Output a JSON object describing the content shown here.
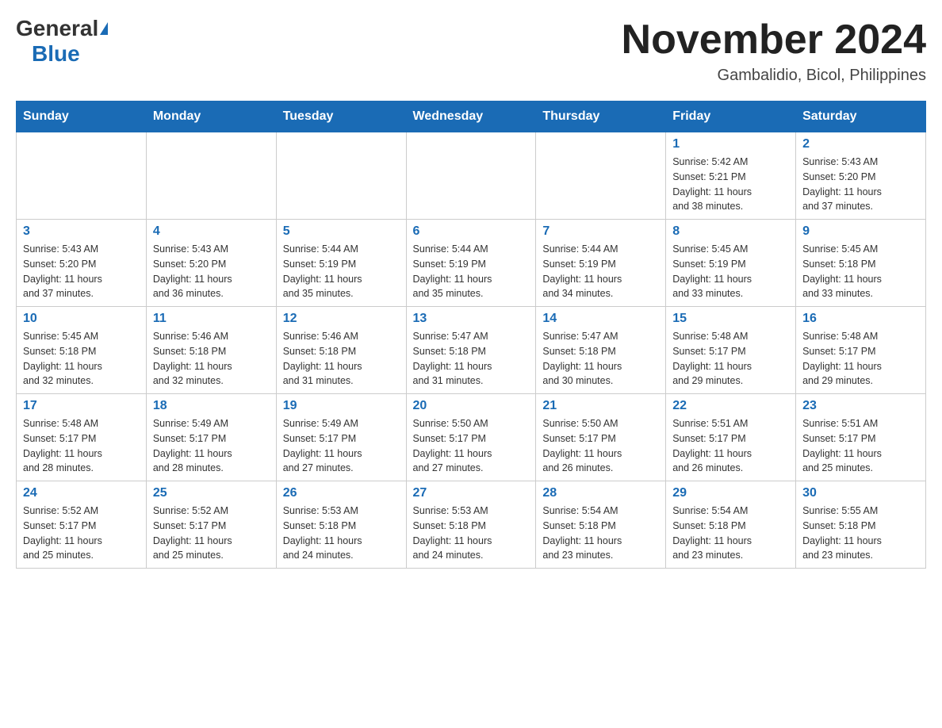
{
  "logo": {
    "general": "General",
    "blue": "Blue"
  },
  "title": {
    "month_year": "November 2024",
    "location": "Gambalidio, Bicol, Philippines"
  },
  "weekdays": [
    "Sunday",
    "Monday",
    "Tuesday",
    "Wednesday",
    "Thursday",
    "Friday",
    "Saturday"
  ],
  "weeks": [
    [
      {
        "day": "",
        "info": ""
      },
      {
        "day": "",
        "info": ""
      },
      {
        "day": "",
        "info": ""
      },
      {
        "day": "",
        "info": ""
      },
      {
        "day": "",
        "info": ""
      },
      {
        "day": "1",
        "info": "Sunrise: 5:42 AM\nSunset: 5:21 PM\nDaylight: 11 hours\nand 38 minutes."
      },
      {
        "day": "2",
        "info": "Sunrise: 5:43 AM\nSunset: 5:20 PM\nDaylight: 11 hours\nand 37 minutes."
      }
    ],
    [
      {
        "day": "3",
        "info": "Sunrise: 5:43 AM\nSunset: 5:20 PM\nDaylight: 11 hours\nand 37 minutes."
      },
      {
        "day": "4",
        "info": "Sunrise: 5:43 AM\nSunset: 5:20 PM\nDaylight: 11 hours\nand 36 minutes."
      },
      {
        "day": "5",
        "info": "Sunrise: 5:44 AM\nSunset: 5:19 PM\nDaylight: 11 hours\nand 35 minutes."
      },
      {
        "day": "6",
        "info": "Sunrise: 5:44 AM\nSunset: 5:19 PM\nDaylight: 11 hours\nand 35 minutes."
      },
      {
        "day": "7",
        "info": "Sunrise: 5:44 AM\nSunset: 5:19 PM\nDaylight: 11 hours\nand 34 minutes."
      },
      {
        "day": "8",
        "info": "Sunrise: 5:45 AM\nSunset: 5:19 PM\nDaylight: 11 hours\nand 33 minutes."
      },
      {
        "day": "9",
        "info": "Sunrise: 5:45 AM\nSunset: 5:18 PM\nDaylight: 11 hours\nand 33 minutes."
      }
    ],
    [
      {
        "day": "10",
        "info": "Sunrise: 5:45 AM\nSunset: 5:18 PM\nDaylight: 11 hours\nand 32 minutes."
      },
      {
        "day": "11",
        "info": "Sunrise: 5:46 AM\nSunset: 5:18 PM\nDaylight: 11 hours\nand 32 minutes."
      },
      {
        "day": "12",
        "info": "Sunrise: 5:46 AM\nSunset: 5:18 PM\nDaylight: 11 hours\nand 31 minutes."
      },
      {
        "day": "13",
        "info": "Sunrise: 5:47 AM\nSunset: 5:18 PM\nDaylight: 11 hours\nand 31 minutes."
      },
      {
        "day": "14",
        "info": "Sunrise: 5:47 AM\nSunset: 5:18 PM\nDaylight: 11 hours\nand 30 minutes."
      },
      {
        "day": "15",
        "info": "Sunrise: 5:48 AM\nSunset: 5:17 PM\nDaylight: 11 hours\nand 29 minutes."
      },
      {
        "day": "16",
        "info": "Sunrise: 5:48 AM\nSunset: 5:17 PM\nDaylight: 11 hours\nand 29 minutes."
      }
    ],
    [
      {
        "day": "17",
        "info": "Sunrise: 5:48 AM\nSunset: 5:17 PM\nDaylight: 11 hours\nand 28 minutes."
      },
      {
        "day": "18",
        "info": "Sunrise: 5:49 AM\nSunset: 5:17 PM\nDaylight: 11 hours\nand 28 minutes."
      },
      {
        "day": "19",
        "info": "Sunrise: 5:49 AM\nSunset: 5:17 PM\nDaylight: 11 hours\nand 27 minutes."
      },
      {
        "day": "20",
        "info": "Sunrise: 5:50 AM\nSunset: 5:17 PM\nDaylight: 11 hours\nand 27 minutes."
      },
      {
        "day": "21",
        "info": "Sunrise: 5:50 AM\nSunset: 5:17 PM\nDaylight: 11 hours\nand 26 minutes."
      },
      {
        "day": "22",
        "info": "Sunrise: 5:51 AM\nSunset: 5:17 PM\nDaylight: 11 hours\nand 26 minutes."
      },
      {
        "day": "23",
        "info": "Sunrise: 5:51 AM\nSunset: 5:17 PM\nDaylight: 11 hours\nand 25 minutes."
      }
    ],
    [
      {
        "day": "24",
        "info": "Sunrise: 5:52 AM\nSunset: 5:17 PM\nDaylight: 11 hours\nand 25 minutes."
      },
      {
        "day": "25",
        "info": "Sunrise: 5:52 AM\nSunset: 5:17 PM\nDaylight: 11 hours\nand 25 minutes."
      },
      {
        "day": "26",
        "info": "Sunrise: 5:53 AM\nSunset: 5:18 PM\nDaylight: 11 hours\nand 24 minutes."
      },
      {
        "day": "27",
        "info": "Sunrise: 5:53 AM\nSunset: 5:18 PM\nDaylight: 11 hours\nand 24 minutes."
      },
      {
        "day": "28",
        "info": "Sunrise: 5:54 AM\nSunset: 5:18 PM\nDaylight: 11 hours\nand 23 minutes."
      },
      {
        "day": "29",
        "info": "Sunrise: 5:54 AM\nSunset: 5:18 PM\nDaylight: 11 hours\nand 23 minutes."
      },
      {
        "day": "30",
        "info": "Sunrise: 5:55 AM\nSunset: 5:18 PM\nDaylight: 11 hours\nand 23 minutes."
      }
    ]
  ]
}
